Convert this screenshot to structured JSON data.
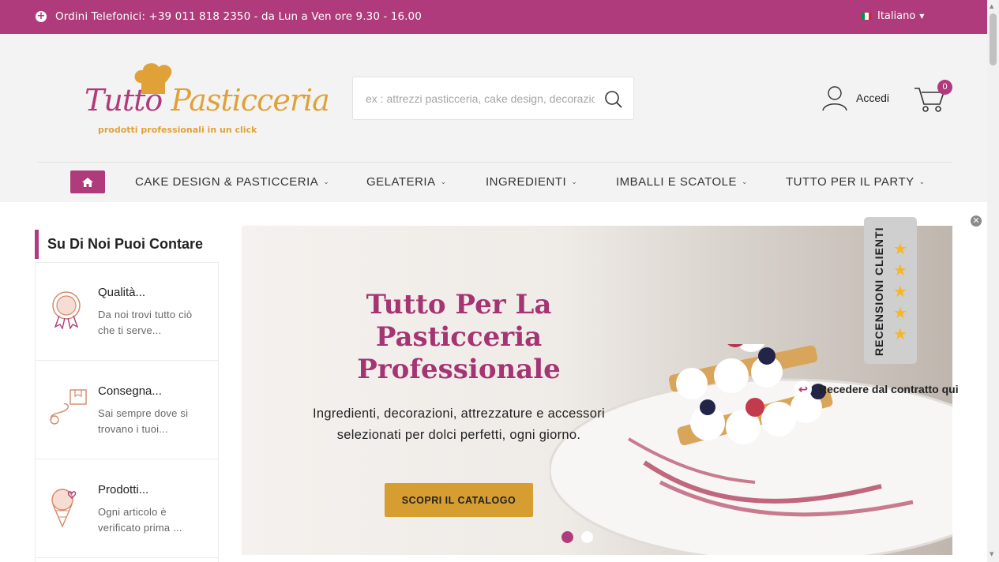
{
  "colors": {
    "brand": "#b03b7c",
    "accent": "#d69d30",
    "star": "#f5b62a"
  },
  "topbar": {
    "phone_icon": "plus-circle-icon",
    "phone_text": "Ordini Telefonici: +39 011 818 2350 - da Lun a Ven ore 9.30 - 16.00",
    "language": "Italiano",
    "language_icon": "italy-flag-icon"
  },
  "logo": {
    "brand_part1": "Tutto ",
    "brand_part2": "Pasticceria",
    "tagline": "prodotti professionali in un click"
  },
  "search": {
    "placeholder": "ex : attrezzi pasticceria, cake design, decorazioni",
    "icon": "search-icon"
  },
  "account": {
    "label": "Accedi",
    "icon": "user-icon"
  },
  "cart": {
    "count": "0",
    "icon": "cart-icon"
  },
  "nav": {
    "home_icon": "home-icon",
    "items": [
      {
        "label": "CAKE DESIGN & PASTICCERIA"
      },
      {
        "label": "GELATERIA"
      },
      {
        "label": "INGREDIENTI"
      },
      {
        "label": "IMBALLI E SCATOLE"
      },
      {
        "label": "TUTTO PER IL PARTY"
      }
    ]
  },
  "sidebar": {
    "title": "Su Di Noi Puoi Contare",
    "features": [
      {
        "name": "Qualità...",
        "desc": "Da noi trovi tutto ciò che ti serve...",
        "icon": "quality-badge-icon"
      },
      {
        "name": "Consegna...",
        "desc": "Sai sempre dove si trovano i tuoi...",
        "icon": "delivery-box-icon"
      },
      {
        "name": "Prodotti...",
        "desc": "Ogni articolo è verificato prima ...",
        "icon": "ice-cream-icon"
      }
    ]
  },
  "banner": {
    "heading": "Tutto Per La Pasticceria Professionale",
    "subtitle": "Ingredienti, decorazioni, attrezzature e accessori selezionati per dolci perfetti, ogni giorno.",
    "cta": "SCOPRI IL CATALOGO",
    "slides": 2,
    "active_slide": 1
  },
  "reviews": {
    "label": "RECENSIONI CLIENTI",
    "stars": 5
  },
  "withdraw": {
    "label": "Recedere dal contratto qui",
    "icon": "return-arrow-icon"
  }
}
